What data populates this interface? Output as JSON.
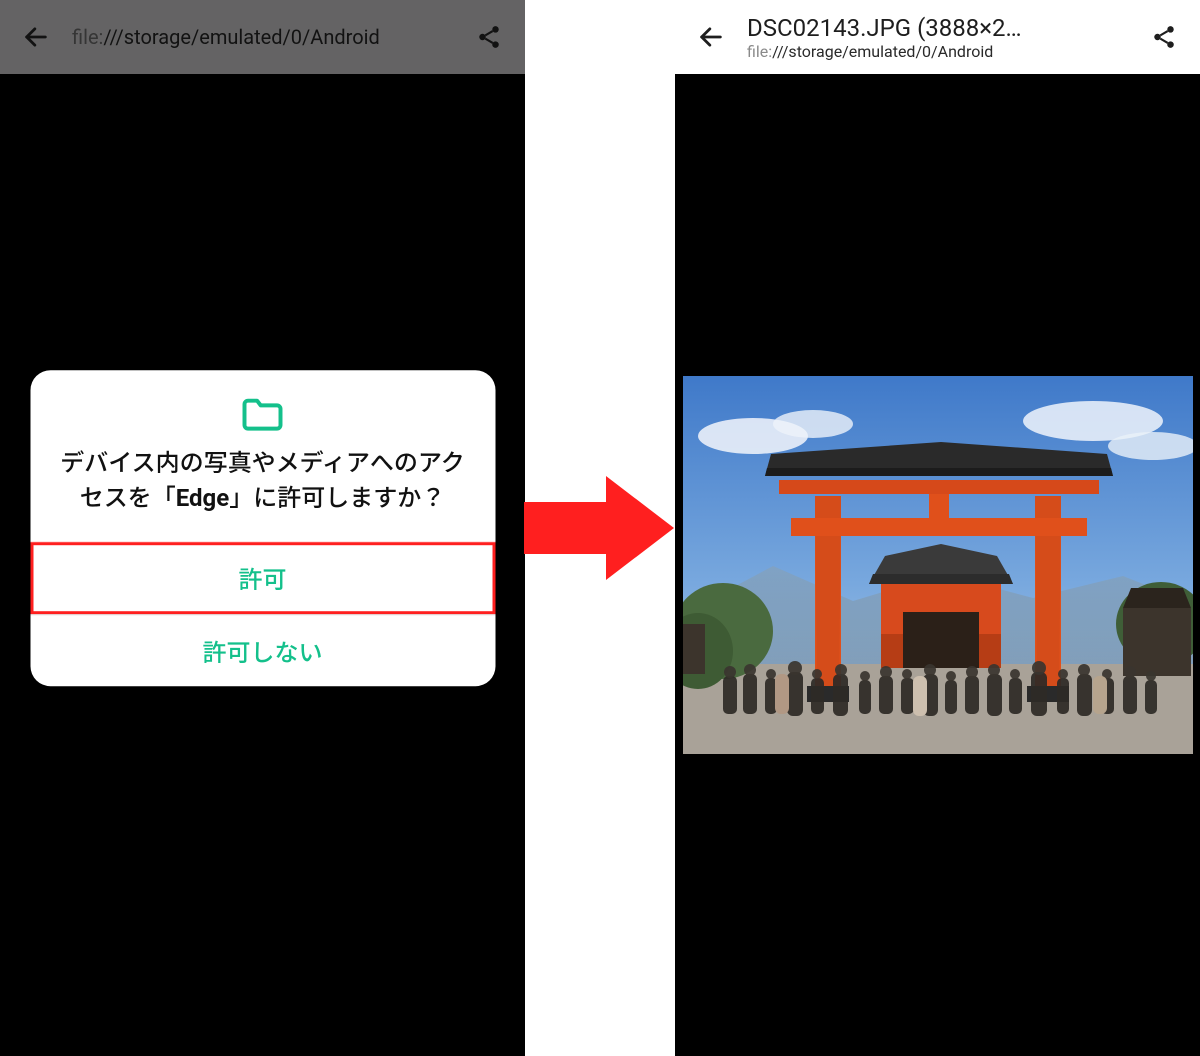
{
  "left": {
    "url_prefix": "file:",
    "url_path": "///storage/emulated/0/Android",
    "dialog": {
      "message_pre": "デバイス内の写真やメディアへのアクセスを「",
      "message_strong": "Edge",
      "message_post": "」に許可しますか？",
      "allow": "許可",
      "deny": "許可しない"
    }
  },
  "right": {
    "title": "DSC02143.JPG (3888×2…",
    "url_prefix": "file:",
    "url_path": "///storage/emulated/0/Android"
  }
}
